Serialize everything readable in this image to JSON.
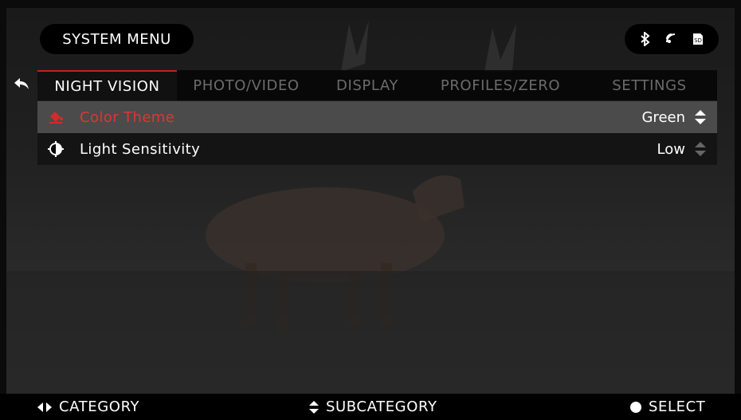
{
  "header": {
    "title": "SYSTEM MENU"
  },
  "status": {
    "icons": [
      "bluetooth-icon",
      "wifi-icon",
      "sd-card-icon"
    ],
    "sd_label": "SD"
  },
  "tabs": [
    {
      "label": "NIGHT VISION",
      "active": true
    },
    {
      "label": "PHOTO/VIDEO",
      "active": false
    },
    {
      "label": "DISPLAY",
      "active": false
    },
    {
      "label": "PROFILES/ZERO",
      "active": false
    },
    {
      "label": "SETTINGS",
      "active": false
    }
  ],
  "settings": [
    {
      "label": "Color Theme",
      "value": "Green",
      "selected": true,
      "icon": "paint-bucket-icon"
    },
    {
      "label": "Light Sensitivity",
      "value": "Low",
      "selected": false,
      "icon": "contrast-icon"
    }
  ],
  "footer": {
    "category_label": "CATEGORY",
    "subcategory_label": "SUBCATEGORY",
    "select_label": "SELECT"
  },
  "colors": {
    "accent": "#c81e1e",
    "selected_row": "#4b4b4b"
  }
}
